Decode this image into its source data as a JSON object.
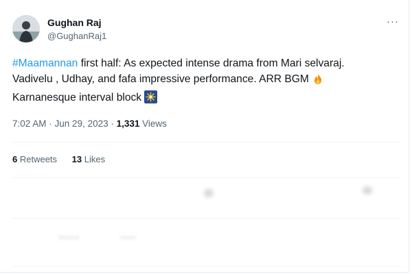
{
  "author": {
    "name": "Gughan Raj",
    "handle": "@GughanRaj1"
  },
  "menu": {
    "more_label": "···"
  },
  "tweet": {
    "hashtag": "#Maamannan",
    "text_line1": " first half: As expected intense drama from Mari selvaraj.",
    "text_line2": "Vadivelu , Udhay, and fafa impressive performance. ARR BGM ",
    "text_line3": "Karnanesque interval block ",
    "emojis": [
      "fire-emoji",
      "sparkler-emoji"
    ]
  },
  "meta": {
    "time": "7:02 AM",
    "separator1": " · ",
    "date": "Jun 29, 2023",
    "separator2": " · ",
    "views_count": "1,331",
    "views_label": " Views"
  },
  "stats": {
    "retweets_count": "6",
    "retweets_label": " Retweets",
    "likes_count": "13",
    "likes_label": " Likes"
  },
  "colors": {
    "accent": "#1d9bf0",
    "text": "#0f1419",
    "secondary": "#536471",
    "divider": "#eff3f4"
  },
  "icons": [
    "reply-icon",
    "retweet-icon",
    "like-icon",
    "share-icon",
    "more-icon"
  ]
}
